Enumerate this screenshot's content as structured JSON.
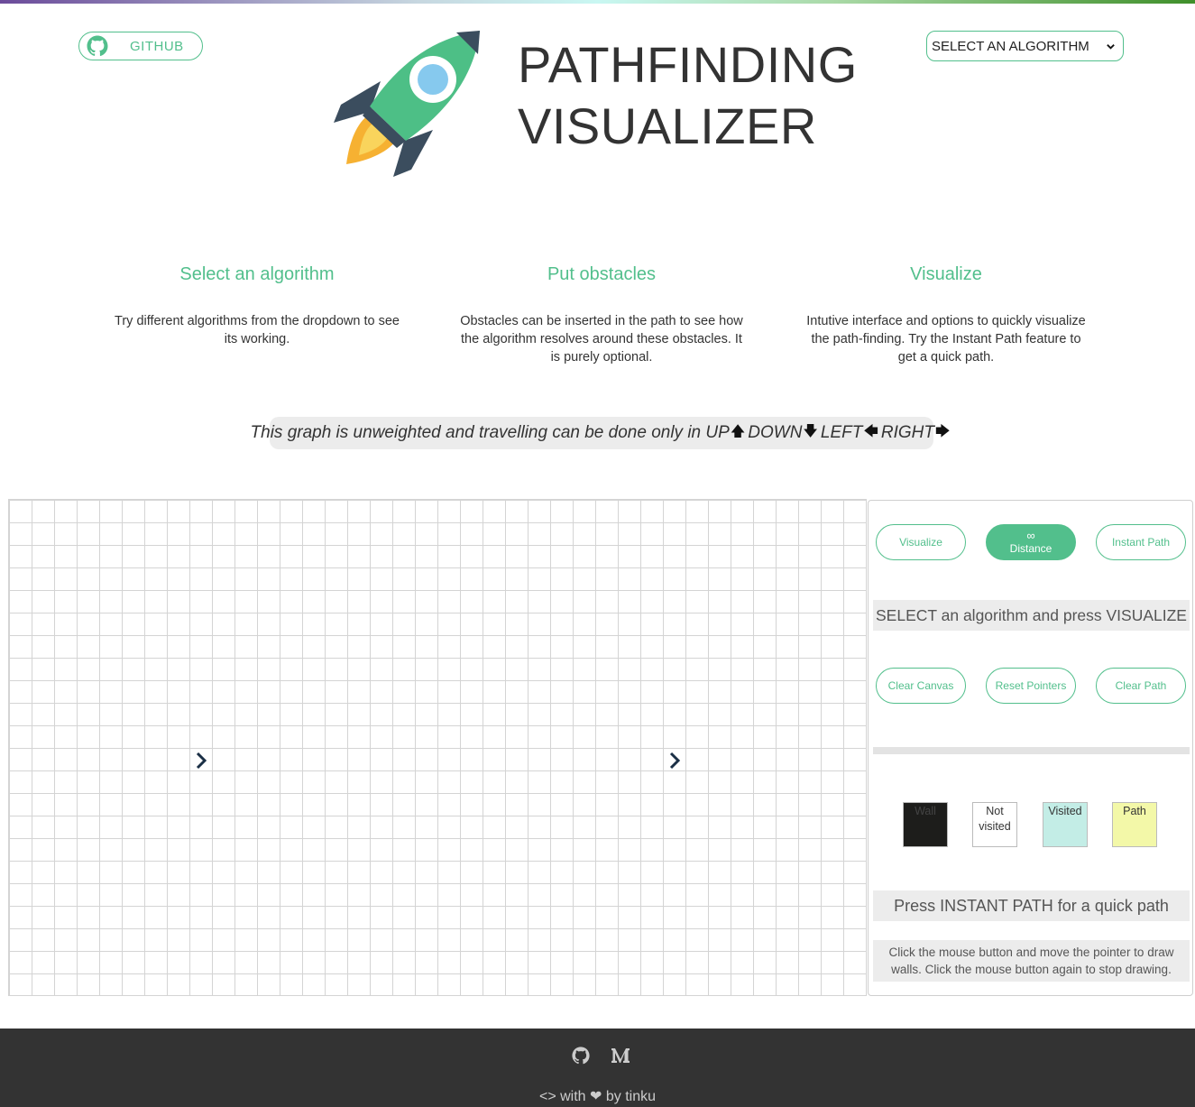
{
  "header": {
    "github_label": "GITHUB",
    "title_line1": "PATHFINDING",
    "title_line2": "VISUALIZER",
    "algorithm_select": "SELECT AN ALGORITHM"
  },
  "features": [
    {
      "title": "Select an algorithm",
      "text": "Try different algorithms from the dropdown to see its working."
    },
    {
      "title": "Put obstacles",
      "text": "Obstacles can be inserted in the path to see how the algorithm resolves around these obstacles. It is purely optional."
    },
    {
      "title": "Visualize",
      "text": "Intutive interface and options to quickly visualize the path-finding. Try the Instant Path feature to get a quick path."
    }
  ],
  "note": {
    "text": "This graph is unweighted and travelling can be done only in",
    "up": "UP",
    "down": "DOWN",
    "left": "LEFT",
    "right": "RIGHT"
  },
  "panel": {
    "visualize": "Visualize",
    "distance_value": "∞",
    "distance_label": "Distance",
    "instant_path": "Instant Path",
    "status": "SELECT an algorithm and press VISUALIZE",
    "clear_canvas": "Clear Canvas",
    "reset_pointers": "Reset Pointers",
    "clear_path": "Clear Path",
    "legend": [
      {
        "label": "Wall",
        "color": "#1d1d1b",
        "text_color": "#444"
      },
      {
        "label": "Not visited",
        "color": "#ffffff",
        "text_color": "#333"
      },
      {
        "label": "Visited",
        "color": "#c3ede6",
        "text_color": "#333"
      },
      {
        "label": "Path",
        "color": "#f3f8a8",
        "text_color": "#333"
      }
    ],
    "instant_hint": "Press INSTANT PATH for a quick path",
    "draw_hint": "Click the mouse button and move the pointer to draw walls. Click the mouse button again to stop drawing."
  },
  "colors": {
    "accent": "#52bf8c",
    "footer_bg": "#333333",
    "grid_line": "#d4d4d4",
    "pointer": "#1a2f45"
  },
  "footer": {
    "icons": [
      "github-icon",
      "medium-icon"
    ],
    "credit_with": "with",
    "credit_by": "by tinku"
  }
}
